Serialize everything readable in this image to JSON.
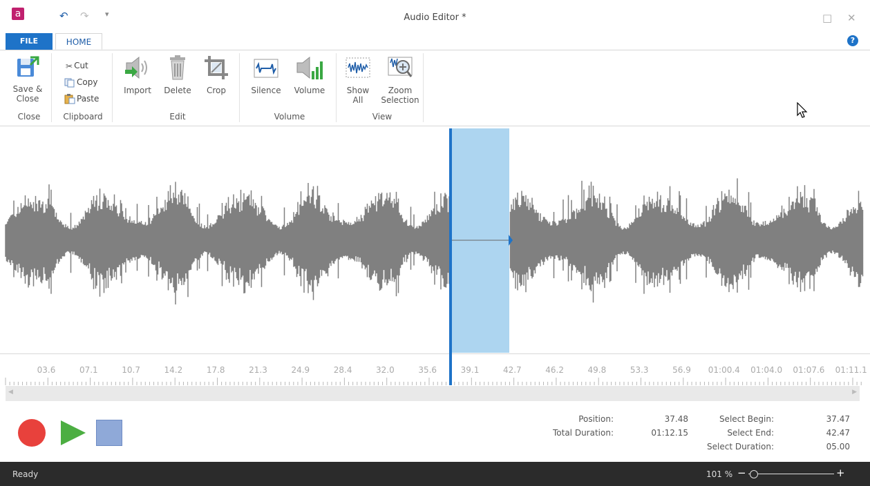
{
  "window": {
    "title": "Audio Editor *",
    "app_icon": "a",
    "maximize_icon": "□",
    "close_icon": "✕"
  },
  "quick_access": {
    "undo_icon": "↶",
    "redo_icon": "↷",
    "more_icon": "▾"
  },
  "tabs": {
    "file": "FILE",
    "home": "HOME"
  },
  "help_icon": "?",
  "ribbon": {
    "groups": {
      "close": "Close",
      "clipboard": "Clipboard",
      "edit": "Edit",
      "volume": "Volume",
      "view": "View"
    },
    "save_close_line1": "Save &",
    "save_close_line2": "Close",
    "cut": "Cut",
    "copy": "Copy",
    "paste": "Paste",
    "import": "Import",
    "delete": "Delete",
    "crop": "Crop",
    "silence": "Silence",
    "volume": "Volume",
    "show_all_line1": "Show",
    "show_all_line2": "All",
    "zoom_sel_line1": "Zoom",
    "zoom_sel_line2": "Selection"
  },
  "timeline": {
    "ticks": [
      "03.6",
      "07.1",
      "10.7",
      "14.2",
      "17.8",
      "21.3",
      "24.9",
      "28.4",
      "32.0",
      "35.6",
      "39.1",
      "42.7",
      "46.2",
      "49.8",
      "53.3",
      "56.9",
      "01:00.4",
      "01:04.0",
      "01:07.6",
      "01:11.1"
    ]
  },
  "scroll": {
    "left_arrow": "◀",
    "right_arrow": "▶"
  },
  "info": {
    "position_label": "Position:",
    "position_value": "37.48",
    "total_duration_label": "Total Duration:",
    "total_duration_value": "01:12.15",
    "select_begin_label": "Select Begin:",
    "select_begin_value": "37.47",
    "select_end_label": "Select End:",
    "select_end_value": "42.47",
    "select_duration_label": "Select Duration:",
    "select_duration_value": "05.00"
  },
  "status": {
    "text": "Ready",
    "zoom": "101 %",
    "zoom_minus": "−",
    "zoom_plus": "+"
  },
  "colors": {
    "accent": "#1e73c8",
    "waveform": "#808080",
    "selection": "#add5f0",
    "record": "#e8413c",
    "play": "#4cae42",
    "stop": "#8fa9d8"
  }
}
